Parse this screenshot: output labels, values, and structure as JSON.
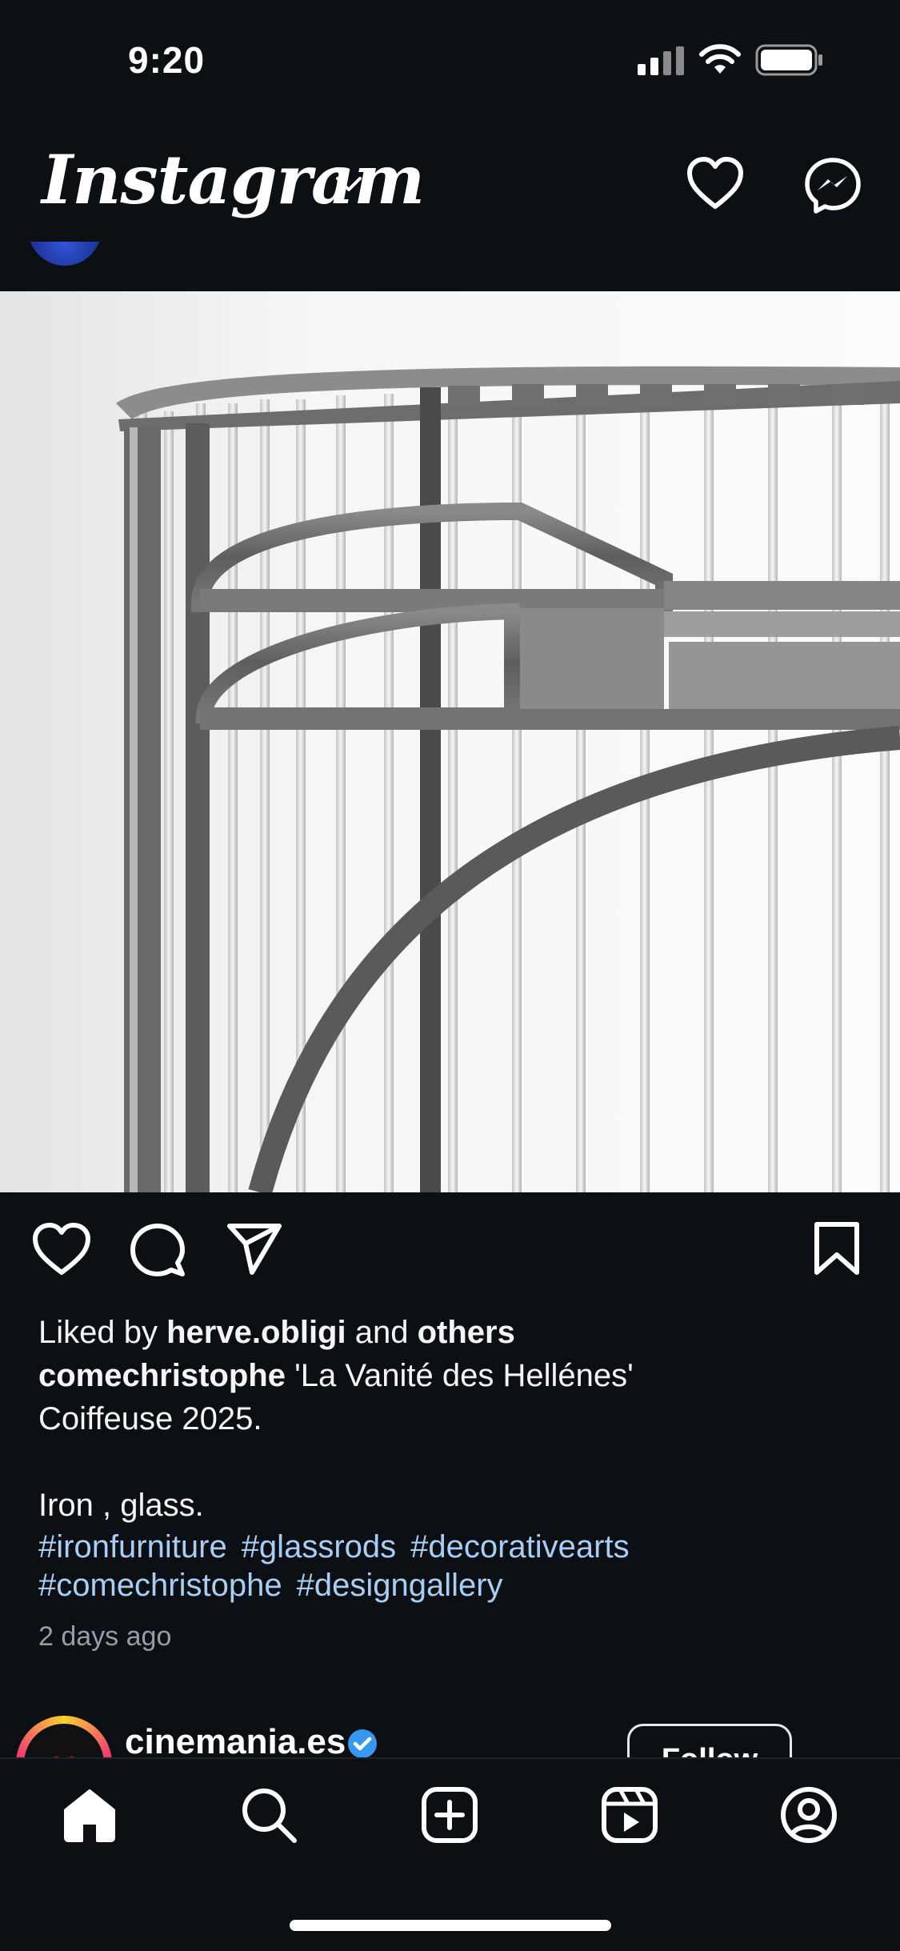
{
  "status_bar": {
    "time": "9:20"
  },
  "header": {
    "brand": "Instagram"
  },
  "post": {
    "likes": {
      "prefix": "Liked by ",
      "user": "herve.obligi",
      "middle": " and ",
      "others": "others"
    },
    "caption": {
      "username": "comechristophe",
      "line1_text": " 'La Vanité des Hellénes'",
      "line2": "Coiffeuse 2025.",
      "line3": "Iron , glass."
    },
    "hashtags_line1": [
      "#ironfurniture",
      "#glassrods",
      "#decorativearts"
    ],
    "hashtags_line2": [
      "#comechristophe",
      "#designgallery"
    ],
    "time_ago": "2 days ago"
  },
  "next_post": {
    "username": "cinemania.es",
    "follow_label": "Follow"
  },
  "colors": {
    "background": "#0c0f14",
    "hashtag": "#a9cef3",
    "muted": "#9a9ca3",
    "verified": "#3897f0"
  },
  "icons": [
    "signal-icon",
    "wifi-icon",
    "battery-icon",
    "chevron-down-icon",
    "heart-icon",
    "messenger-icon",
    "comment-icon",
    "share-icon",
    "bookmark-icon",
    "verified-icon",
    "home-icon",
    "search-icon",
    "create-icon",
    "reels-icon",
    "profile-icon"
  ]
}
